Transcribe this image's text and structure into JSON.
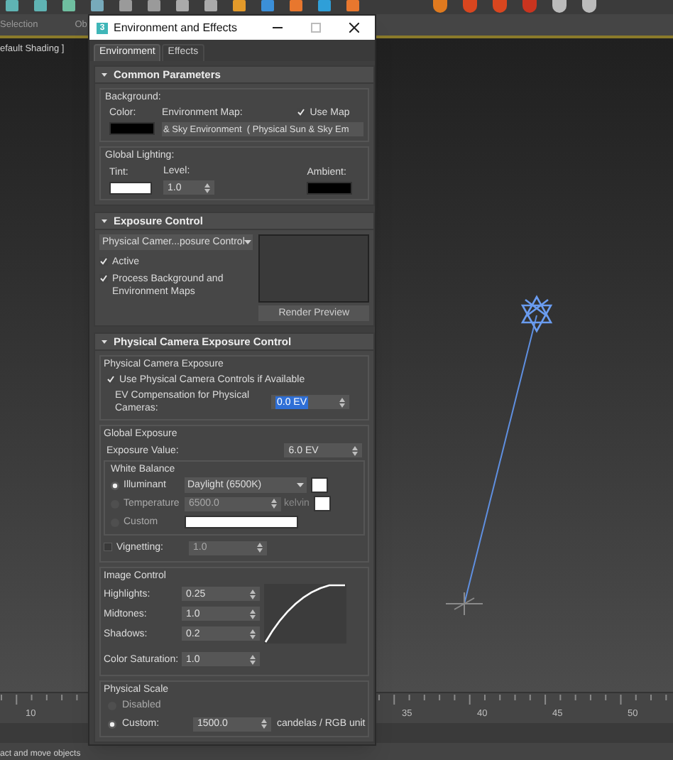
{
  "toolbar": {
    "panel_label": "Selection",
    "cut_label": "Ob"
  },
  "viewport": {
    "label": "efault Shading ]"
  },
  "dialog": {
    "app_icon": "3",
    "title": "Environment and Effects",
    "tabs": [
      {
        "label": "Environment",
        "selected": true
      },
      {
        "label": "Effects",
        "selected": false
      }
    ],
    "common_parameters": {
      "title": "Common Parameters",
      "expanded": true,
      "background": {
        "title": "Background:",
        "color_label": "Color:",
        "color": "#000000",
        "map_label": "Environment Map:",
        "use_map": {
          "label": "Use Map",
          "checked": true
        },
        "map_button": "& Sky Environment  ( Physical Sun & Sky Em"
      },
      "global_lighting": {
        "title": "Global Lighting:",
        "tint": {
          "label": "Tint:",
          "color": "#ffffff"
        },
        "level_label": "Level:",
        "level_value": "1.0",
        "ambient": {
          "label": "Ambient:",
          "color": "#000000"
        }
      }
    },
    "exposure_control": {
      "title": "Exposure Control",
      "expanded": true,
      "type_dropdown": "Physical Camer...posure Control",
      "checkboxes": [
        {
          "label": "Active",
          "checked": true
        },
        {
          "label": "Process Background and Environment Maps",
          "checked": true
        }
      ],
      "render_preview_button": "Render Preview"
    },
    "physical_camera": {
      "title": "Physical Camera Exposure Control",
      "expanded": true,
      "camera_exposure": {
        "title": "Physical Camera Exposure",
        "use_controls": {
          "label": "Use Physical Camera Controls if Available",
          "checked": true
        },
        "ev_label": "EV Compensation for Physical Cameras:",
        "ev_value": "0.0 EV",
        "ev_value_selected": true
      },
      "global_exposure": {
        "title": "Global Exposure",
        "exposure_label": "Exposure Value:",
        "exposure_value": "6.0 EV",
        "white_balance": {
          "title": "White Balance",
          "options": [
            {
              "kind": "dropdown",
              "label": "Illuminant",
              "selected": true,
              "value": "Daylight (6500K)",
              "color": "#ffffff"
            },
            {
              "kind": "spinner",
              "label": "Temperature",
              "selected": false,
              "value": "6500.0",
              "unit": "kelvin",
              "color": "#ffffff"
            },
            {
              "kind": "swatch",
              "label": "Custom",
              "selected": false,
              "color": "#ffffff"
            }
          ]
        },
        "vignetting": {
          "label": "Vignetting:",
          "checked": false,
          "value": "1.0"
        }
      },
      "image_control": {
        "title": "Image Control",
        "spinners": [
          {
            "label": "Highlights:",
            "value": "0.25"
          },
          {
            "label": "Midtones:",
            "value": "1.0"
          },
          {
            "label": "Shadows:",
            "value": "0.2"
          }
        ],
        "saturation_label": "Color Saturation:",
        "saturation_value": "1.0"
      },
      "physical_scale": {
        "title": "Physical Scale",
        "options": [
          {
            "label": "Disabled",
            "selected": false
          },
          {
            "label": "Custom:",
            "selected": true,
            "value": "1500.0",
            "unit": "candelas / RGB unit"
          }
        ]
      }
    }
  },
  "timeline": {
    "labels": [
      "10",
      "35",
      "40",
      "45",
      "50"
    ]
  },
  "status_bar": {
    "prompt": "act and move objects"
  }
}
